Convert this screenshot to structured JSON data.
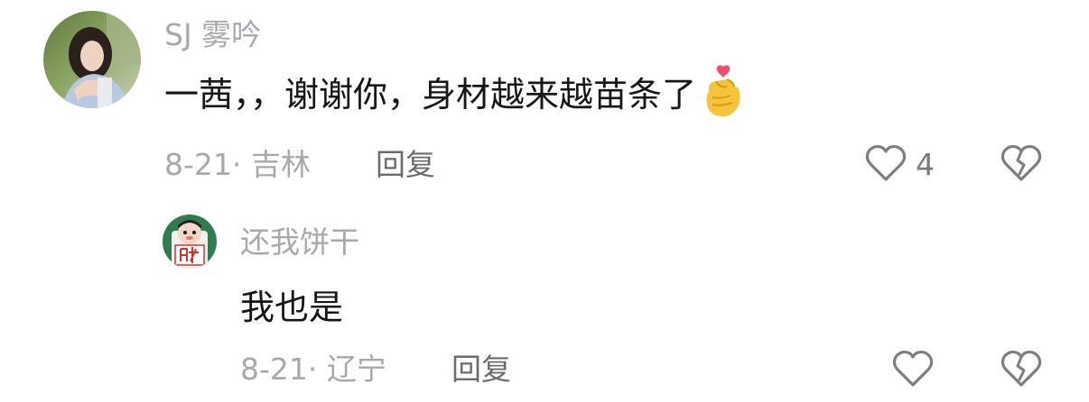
{
  "comment": {
    "username": "SJ 雾吟",
    "text": "一茜，，谢谢你，身材越来越苗条了",
    "emoji_icon": "finger-heart-icon",
    "date_location": "8-21· 吉林",
    "reply_label": "回复",
    "like_icon": "heart-outline-icon",
    "like_count": "4",
    "dislike_icon": "broken-heart-icon"
  },
  "reply": {
    "username": "还我饼干",
    "text": "我也是",
    "date_location": "8-21· 辽宁",
    "reply_label": "回复",
    "like_icon": "heart-outline-icon",
    "dislike_icon": "broken-heart-icon"
  },
  "colors": {
    "primary_text": "#161616",
    "secondary_text": "#a9a9ad",
    "reply_text": "#6b6b70",
    "icon_stroke": "#7d7d82"
  }
}
